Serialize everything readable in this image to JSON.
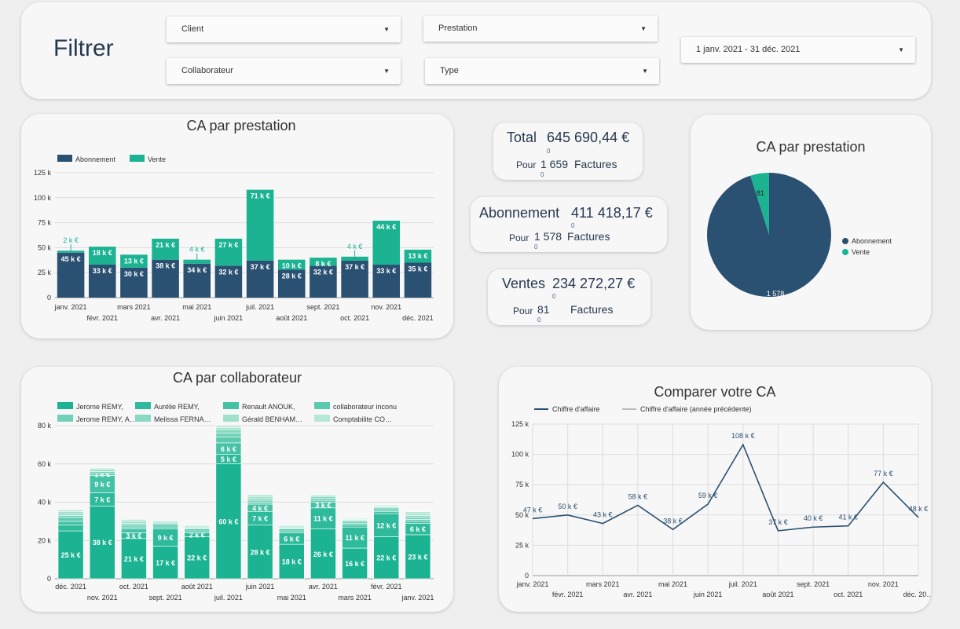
{
  "filters": {
    "title": "Filtrer",
    "client": "Client",
    "prestation": "Prestation",
    "collaborateur": "Collaborateur",
    "type": "Type",
    "date_range": "1 janv. 2021 - 31 déc. 2021"
  },
  "kpis": {
    "total": {
      "label": "Total",
      "amount": "645 690,44 €",
      "delta": "0",
      "pour": "Pour",
      "count": "1 659",
      "count_delta": "0",
      "unit": "Factures"
    },
    "abonnement": {
      "label": "Abonnement",
      "amount": "411 418,17 €",
      "delta": "0",
      "pour": "Pour",
      "count": "1 578",
      "count_delta": "0",
      "unit": "Factures"
    },
    "ventes": {
      "label": "Ventes",
      "amount": "234 272,27 €",
      "delta": "0",
      "pour": "Pour",
      "count": "81",
      "count_delta": "0",
      "unit": "Factures"
    }
  },
  "colors": {
    "navy": "#2a5072",
    "green": "#1bb392"
  },
  "chart_data": [
    {
      "type": "bar",
      "title": "CA par prestation",
      "stacked": true,
      "categories": [
        "janv. 2021",
        "févr. 2021",
        "mars 2021",
        "avr. 2021",
        "mai 2021",
        "juin 2021",
        "juil. 2021",
        "août 2021",
        "sept. 2021",
        "oct. 2021",
        "nov. 2021",
        "déc. 2021"
      ],
      "series": [
        {
          "name": "Abonnement",
          "color": "#2a5072",
          "values": [
            45,
            33,
            30,
            38,
            34,
            32,
            37,
            28,
            32,
            37,
            33,
            35
          ],
          "labels": [
            "45 k €",
            "33 k €",
            "30 k €",
            "38 k €",
            "34 k €",
            "32 k €",
            "37 k €",
            "28 k €",
            "32 k €",
            "37 k €",
            "33 k €",
            "35 k €"
          ]
        },
        {
          "name": "Vente",
          "color": "#1bb392",
          "values": [
            2,
            18,
            13,
            21,
            4,
            27,
            71,
            10,
            8,
            4,
            44,
            13
          ],
          "labels": [
            "2 k €",
            "18 k €",
            "13 k €",
            "21 k €",
            "4 k €",
            "27 k €",
            "71 k €",
            "10 k €",
            "8 k €",
            "4 k €",
            "44 k €",
            "13 k €"
          ]
        }
      ],
      "ylim": [
        0,
        125
      ],
      "yticks": [
        "0",
        "25 k",
        "50 k",
        "75 k",
        "100 k",
        "125 k"
      ],
      "legend": "top-left"
    },
    {
      "type": "pie",
      "title": "CA par prestation",
      "slices": [
        {
          "name": "Abonnement",
          "value": 1578,
          "label": "1 578",
          "color": "#2a5072"
        },
        {
          "name": "Vente",
          "value": 81,
          "label": "81",
          "color": "#1bb392"
        }
      ],
      "legend": "right"
    },
    {
      "type": "bar",
      "title": "CA par collaborateur",
      "stacked": true,
      "legend_entries": [
        {
          "name": "Jerome REMY,",
          "color": "#1bb392"
        },
        {
          "name": "Aurélie REMY,",
          "color": "#2fbb9b"
        },
        {
          "name": "Renault ANOUK,",
          "color": "#45c2a5"
        },
        {
          "name": "collaborateur inconu",
          "color": "#5ccaaf"
        },
        {
          "name": "Jerome REMY, A…",
          "color": "#72d1b9"
        },
        {
          "name": "Melissa FERNA…",
          "color": "#89d9c3"
        },
        {
          "name": "Gérald BENHAM…",
          "color": "#a0e0cd"
        },
        {
          "name": "Comptabilite CO…",
          "color": "#b6e8d7"
        }
      ],
      "categories": [
        "déc. 2021",
        "nov. 2021",
        "oct. 2021",
        "sept. 2021",
        "août 2021",
        "juil. 2021",
        "juin 2021",
        "mai 2021",
        "avr. 2021",
        "mars 2021",
        "févr. 2021",
        "janv. 2021"
      ],
      "segments": [
        [
          25,
          3,
          2,
          2,
          1,
          1,
          1,
          1
        ],
        [
          38,
          7,
          9,
          1,
          1,
          1,
          0.5,
          0.5
        ],
        [
          21,
          3,
          2,
          1,
          1,
          1,
          1,
          1
        ],
        [
          17,
          9,
          1,
          1,
          1,
          0.5,
          0.5,
          0.5
        ],
        [
          22,
          2,
          1,
          1,
          0.5,
          0.5,
          0.5,
          0.5
        ],
        [
          60,
          5,
          6,
          3,
          2,
          2,
          1,
          1
        ],
        [
          28,
          7,
          4,
          1,
          1,
          1,
          1,
          1
        ],
        [
          18,
          6,
          1,
          1,
          0.5,
          0.5,
          0.5,
          0.5
        ],
        [
          26,
          11,
          3,
          1,
          1,
          1,
          0.5,
          0.5
        ],
        [
          16,
          11,
          1,
          1,
          1,
          0.5,
          0.5,
          0.5
        ],
        [
          22,
          12,
          1,
          1,
          1,
          0.5,
          0.5,
          0.5
        ],
        [
          23,
          6,
          1,
          1,
          1,
          1,
          1,
          1
        ]
      ],
      "labels": [
        [
          "25 k €",
          "",
          "",
          "",
          "",
          "",
          "",
          ""
        ],
        [
          "38 k €",
          "7 k €",
          "9 k €",
          "1 k €",
          "",
          "",
          "",
          ""
        ],
        [
          "21 k €",
          "3 k €",
          "",
          "",
          "",
          "",
          "",
          ""
        ],
        [
          "17 k €",
          "9 k €",
          "",
          "",
          "",
          "",
          "",
          ""
        ],
        [
          "22 k €",
          "2 k €",
          "",
          "",
          "",
          "",
          "",
          ""
        ],
        [
          "60 k €",
          "5 k €",
          "6 k €",
          "",
          "",
          "",
          "",
          ""
        ],
        [
          "28 k €",
          "7 k €",
          "4 k €",
          "",
          "",
          "",
          "",
          ""
        ],
        [
          "18 k €",
          "6 k €",
          "",
          "",
          "",
          "",
          "",
          ""
        ],
        [
          "26 k €",
          "11 k €",
          "3 k €",
          "",
          "",
          "",
          "",
          ""
        ],
        [
          "16 k €",
          "11 k €",
          "",
          "",
          "",
          "",
          "",
          ""
        ],
        [
          "22 k €",
          "12 k €",
          "",
          "",
          "",
          "",
          "",
          ""
        ],
        [
          "23 k €",
          "6 k €",
          "",
          "",
          "",
          "",
          "",
          ""
        ]
      ],
      "ylim": [
        0,
        80
      ],
      "yticks": [
        "0",
        "20 k",
        "40 k",
        "60 k",
        "80 k"
      ],
      "legend": "top"
    },
    {
      "type": "line",
      "title": "Comparer votre CA",
      "categories": [
        "janv. 2021",
        "févr. 2021",
        "mars 2021",
        "avr. 2021",
        "mai 2021",
        "juin 2021",
        "juil. 2021",
        "août 2021",
        "sept. 2021",
        "oct. 2021",
        "nov. 2021",
        "déc. 20…"
      ],
      "series": [
        {
          "name": "Chiffre d'affaire",
          "color": "#2a5072",
          "values": [
            47,
            50,
            43,
            58,
            38,
            59,
            108,
            37,
            40,
            41,
            77,
            48
          ],
          "labels": [
            "47 k €",
            "50 k €",
            "43 k €",
            "58 k €",
            "38 k €",
            "59 k €",
            "108 k €",
            "37 k €",
            "40 k €",
            "41 k €",
            "77 k €",
            "48 k €"
          ]
        },
        {
          "name": "Chiffre d'affaire (année précédente)",
          "color": "#bbbbbb",
          "values": []
        }
      ],
      "ylim": [
        0,
        125
      ],
      "yticks": [
        "0",
        "25 k",
        "50 k",
        "75 k",
        "100 k",
        "125 k"
      ],
      "grid": true,
      "legend": "top-left"
    }
  ]
}
